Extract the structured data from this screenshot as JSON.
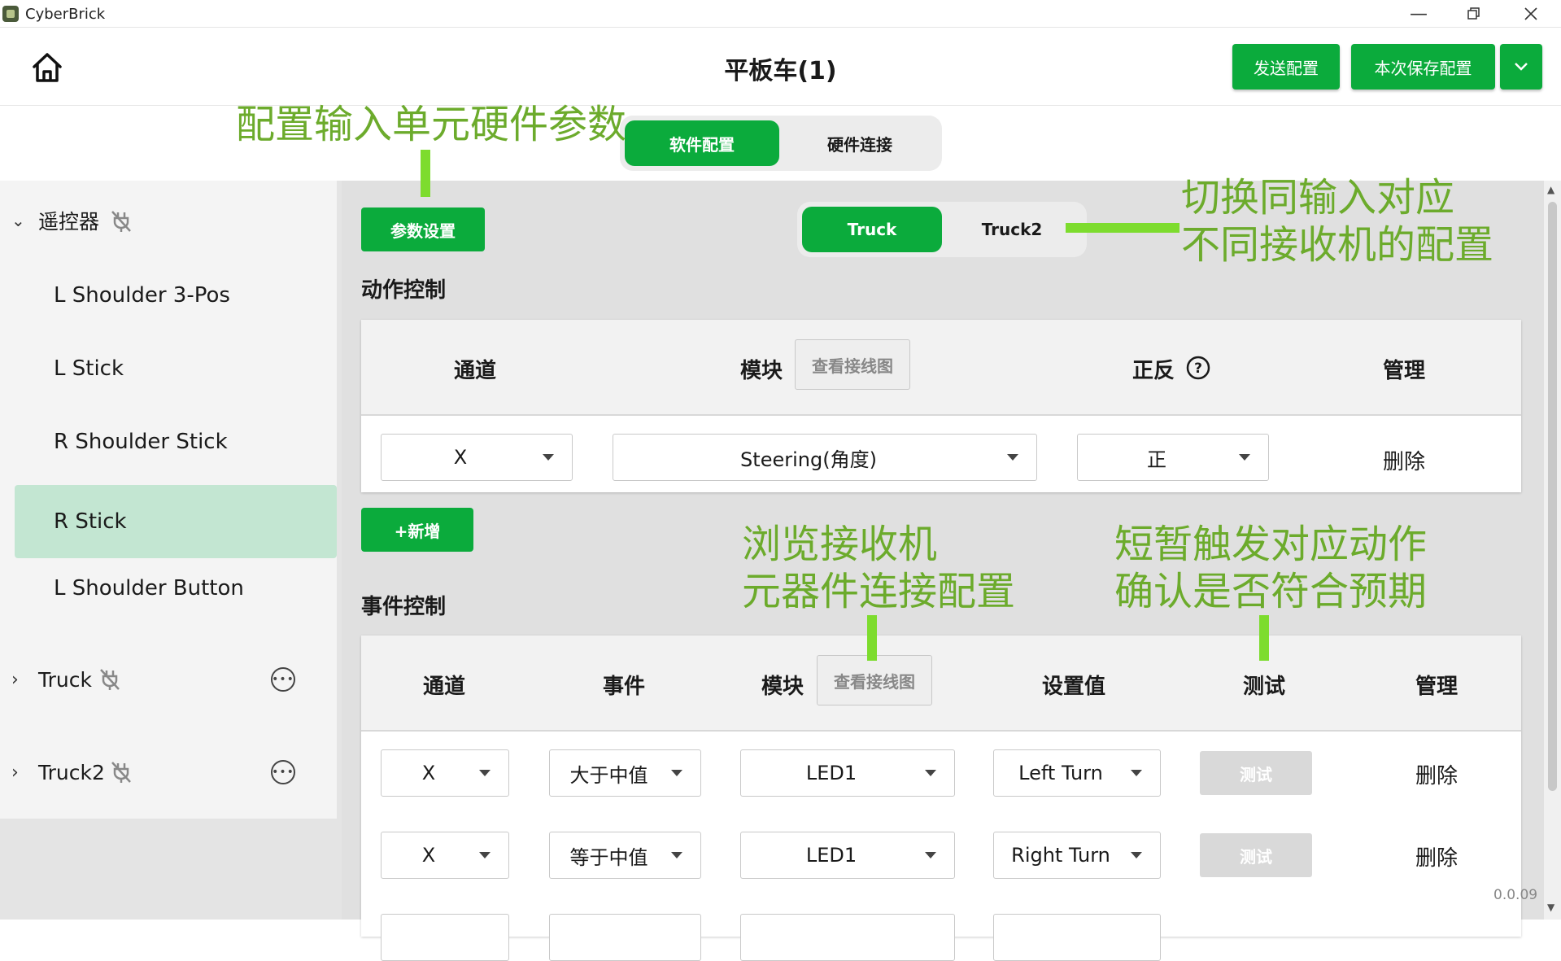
{
  "window": {
    "title": "CyberBrick"
  },
  "header": {
    "title": "平板车(1)",
    "send_label": "发送配置",
    "save_label": "本次保存配置"
  },
  "main_tabs": [
    {
      "label": "软件配置",
      "active": true
    },
    {
      "label": "硬件连接",
      "active": false
    }
  ],
  "sidebar": {
    "group": {
      "label": "遥控器",
      "expanded": true
    },
    "items": [
      {
        "label": "L Shoulder 3-Pos",
        "selected": false
      },
      {
        "label": "L Stick",
        "selected": false
      },
      {
        "label": "R Shoulder Stick",
        "selected": false
      },
      {
        "label": "R Stick",
        "selected": true
      },
      {
        "label": "L Shoulder Button",
        "selected": false
      }
    ],
    "receivers": [
      {
        "label": "Truck",
        "expanded": false
      },
      {
        "label": "Truck2",
        "expanded": false
      }
    ]
  },
  "content": {
    "param_button": "参数设置",
    "receiver_tabs": [
      {
        "label": "Truck",
        "active": true
      },
      {
        "label": "Truck2",
        "active": false
      }
    ],
    "action_section": {
      "title": "动作控制",
      "headers": {
        "channel": "通道",
        "module": "模块",
        "wiring": "查看接线图",
        "direction": "正反",
        "manage": "管理"
      },
      "rows": [
        {
          "channel": "X",
          "module": "Steering(角度)",
          "direction": "正",
          "action": "删除"
        }
      ],
      "add_label": "+新增"
    },
    "event_section": {
      "title": "事件控制",
      "headers": {
        "channel": "通道",
        "event": "事件",
        "module": "模块",
        "wiring": "查看接线图",
        "value": "设置值",
        "test": "测试",
        "manage": "管理"
      },
      "rows": [
        {
          "channel": "X",
          "event": "大于中值",
          "module": "LED1",
          "value": "Left Turn",
          "test": "测试",
          "action": "删除"
        },
        {
          "channel": "X",
          "event": "等于中值",
          "module": "LED1",
          "value": "Right Turn",
          "test": "测试",
          "action": "删除"
        }
      ]
    }
  },
  "annotations": {
    "hardware_params": "配置输入单元硬件参数",
    "switch_receiver": "切换同输入对应\n不同接收机的配置",
    "browse_wiring": "浏览接收机\n元器件连接配置",
    "trigger_test": "短暂触发对应动作\n确认是否符合预期"
  },
  "version": "0.0.09",
  "colors": {
    "accent": "#0bab3c",
    "annotation": "#6cab2c",
    "selected": "#c3e6d2"
  }
}
